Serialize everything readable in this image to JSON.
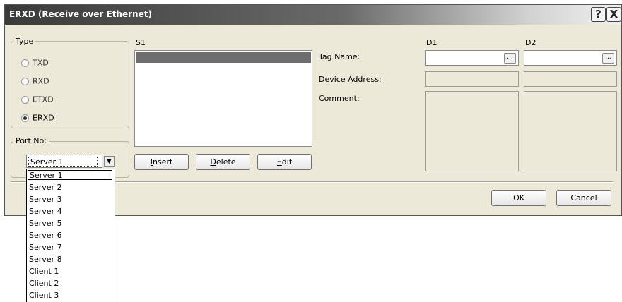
{
  "window": {
    "title": "ERXD (Receive over Ethernet)",
    "help_glyph": "?",
    "close_glyph": "X"
  },
  "type_group": {
    "label": "Type",
    "options": [
      {
        "label": "TXD",
        "selected": false
      },
      {
        "label": "RXD",
        "selected": false
      },
      {
        "label": "ETXD",
        "selected": false
      },
      {
        "label": "ERXD",
        "selected": true
      }
    ]
  },
  "port_group": {
    "label": "Port No:",
    "value": "Server 1",
    "arrow": "▼",
    "options": [
      "Server 1",
      "Server 2",
      "Server 3",
      "Server 4",
      "Server 5",
      "Server 6",
      "Server 7",
      "Server 8",
      "Client 1",
      "Client 2",
      "Client 3"
    ],
    "selected_index": 0
  },
  "s1": {
    "label": "S1",
    "buttons": {
      "insert": {
        "mnemonic": "I",
        "rest": "nsert"
      },
      "delete": {
        "mnemonic": "D",
        "rest": "elete"
      },
      "edit": {
        "mnemonic": "E",
        "rest": "dit"
      }
    }
  },
  "labels": {
    "tag_name": "Tag Name:",
    "device_address": "Device Address:",
    "comment": "Comment:"
  },
  "d1": {
    "label": "D1",
    "tag_name": "",
    "device_address": "",
    "comment": ""
  },
  "d2": {
    "label": "D2",
    "tag_name": "",
    "device_address": "",
    "comment": ""
  },
  "ellipsis": "...",
  "footer": {
    "ok": "OK",
    "cancel": "Cancel"
  }
}
